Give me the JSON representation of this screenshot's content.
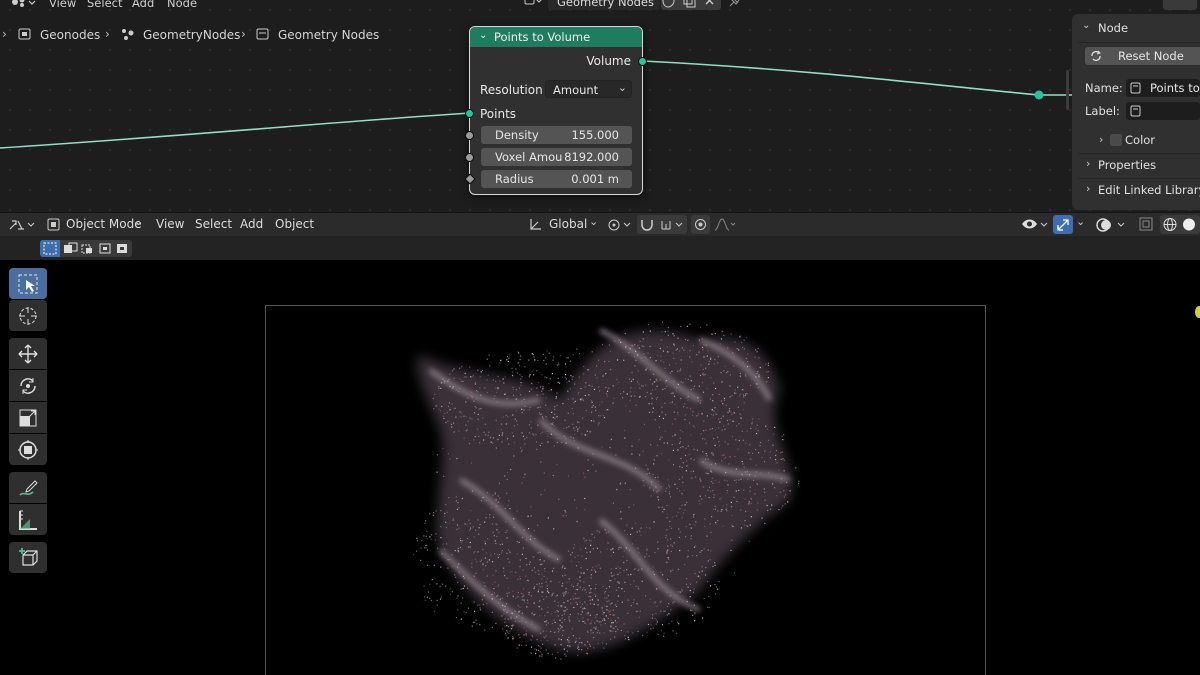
{
  "node_editor": {
    "menu": [
      "View",
      "Select",
      "Add",
      "Node"
    ],
    "tree_name": "Geometry Nodes",
    "breadcrumbs": [
      "Geonodes",
      "GeometryNodes",
      "Geometry Nodes"
    ]
  },
  "node": {
    "title": "Points to Volume",
    "output_label": "Volume",
    "resolution_label": "Resolution",
    "resolution_value": "Amount",
    "points_label": "Points",
    "fields": [
      {
        "label": "Density",
        "value": "155.000"
      },
      {
        "label": "Voxel Amou",
        "value": "8192.000"
      },
      {
        "label": "Radius",
        "value": "0.001 m"
      }
    ],
    "header_color": "#1e7d5f",
    "link_color": "#7fd8c0"
  },
  "properties": {
    "panel_title": "Node",
    "reset_label": "Reset Node",
    "name_label": "Name:",
    "name_value": "Points to V",
    "label_label": "Label:",
    "label_value": "",
    "color_label": "Color",
    "properties_label": "Properties",
    "linked_label": "Edit Linked Library"
  },
  "viewport": {
    "mode": "Object Mode",
    "menu": [
      "View",
      "Select",
      "Add",
      "Object"
    ],
    "transform_orientation": "Global"
  },
  "toolbar": {
    "tools": [
      "select-box",
      "cursor",
      "move",
      "rotate",
      "scale",
      "transform",
      "annotate",
      "measure",
      "add-cube"
    ]
  }
}
